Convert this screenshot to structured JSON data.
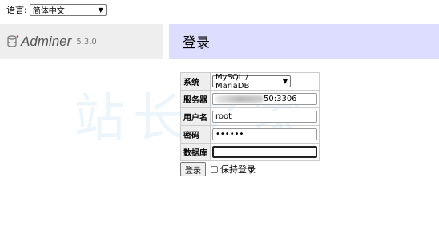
{
  "language": {
    "label": "语言:",
    "selected": "简体中文"
  },
  "logo": {
    "name": "Adminer",
    "version": "5.3.0"
  },
  "header": {
    "title": "登录"
  },
  "watermark": {
    "text": "站长之家"
  },
  "form": {
    "system": {
      "label": "系统",
      "value": "MySQL / MariaDB"
    },
    "server": {
      "label": "服务器",
      "value_visible": "50:3306"
    },
    "username": {
      "label": "用户名",
      "value": "root"
    },
    "password": {
      "label": "密码",
      "value": "••••••"
    },
    "database": {
      "label": "数据库",
      "value": ""
    }
  },
  "actions": {
    "login_button": "登录",
    "permanent_login": "保持登录"
  }
}
